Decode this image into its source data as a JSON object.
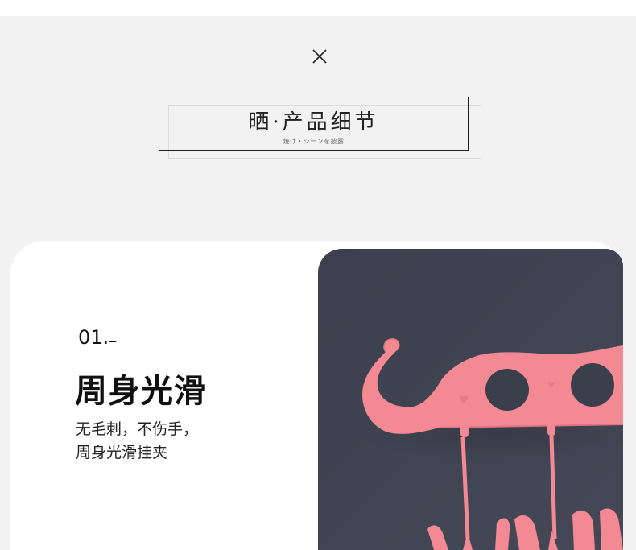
{
  "header": {
    "close_icon": "close-icon",
    "title": "晒·产品细节",
    "subtitle": "焼け・シーンを披露"
  },
  "feature": {
    "number": "01.",
    "title": "周身光滑",
    "description_line_1": "无毛刺，不伤手，",
    "description_line_2": "周身光滑挂夹"
  },
  "colors": {
    "page_background": "#f2f2f2",
    "card_background": "#ffffff",
    "photo_background": "#3f4250",
    "hanger_pink": "#f38a93"
  }
}
